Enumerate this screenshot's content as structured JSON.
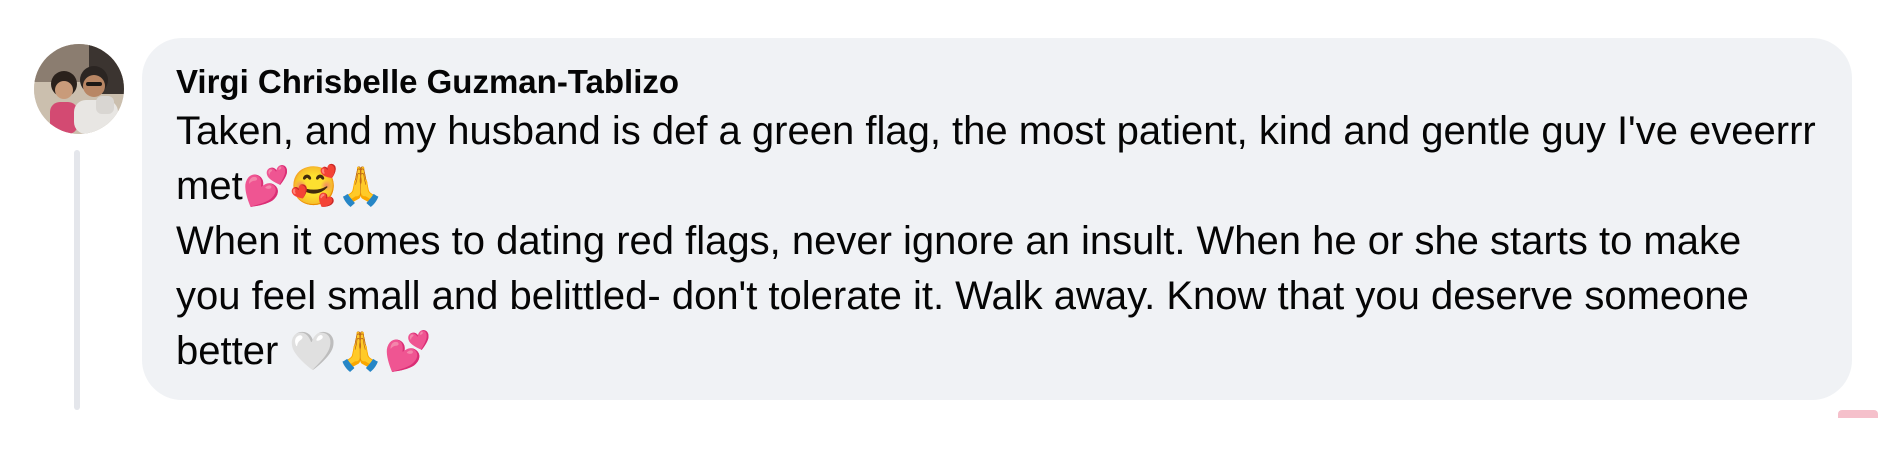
{
  "comment": {
    "author_name": "Virgi Chrisbelle Guzman-Tablizo",
    "paragraph_1": "Taken, and my husband is def a green flag, the most patient, kind and gentle guy I've eveerrr met",
    "paragraph_1_emojis": "💕🥰🙏",
    "paragraph_2": "When it comes to dating red flags, never ignore an insult. When he or she starts to make you feel small and belittled- don't tolerate it. Walk away. Know that you deserve someone better ",
    "paragraph_2_emojis": "🤍🙏💕"
  },
  "colors": {
    "bubble_background": "#f0f2f5",
    "text": "#050505",
    "thread_line": "#e4e6eb"
  },
  "icons": {
    "avatar": "profile-photo"
  }
}
